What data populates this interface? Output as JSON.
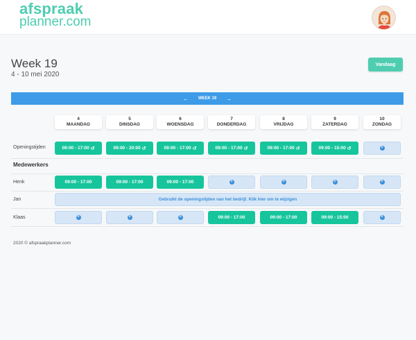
{
  "header": {
    "logo_line1": "afspraak",
    "logo_line2": "planner.com"
  },
  "page": {
    "title": "Week 19",
    "date_range": "4 - 10 mei 2020",
    "today_label": "Vandaag"
  },
  "week_nav": {
    "prev": "←",
    "label": "WEEK 19",
    "next": "→"
  },
  "days": [
    {
      "num": "4",
      "name": "MAANDAG"
    },
    {
      "num": "5",
      "name": "DINSDAG"
    },
    {
      "num": "6",
      "name": "WOENSDAG"
    },
    {
      "num": "7",
      "name": "DONDERDAG"
    },
    {
      "num": "8",
      "name": "VRIJDAG"
    },
    {
      "num": "9",
      "name": "ZATERDAG"
    },
    {
      "num": "10",
      "name": "ZONDAG"
    }
  ],
  "opening_hours": {
    "label": "Openingstijden",
    "slots": [
      "09:00 - 17:00",
      "09:00 - 20:00",
      "09:00 - 17:00",
      "09:00 - 17:00",
      "09:00 - 17:00",
      "09:00 - 15:00",
      ""
    ]
  },
  "staff_section": "Medewerkers",
  "staff": [
    {
      "name": "Henk",
      "slots": [
        "09:00 - 17:00",
        "09:00 - 17:00",
        "09:00 - 17:00",
        "",
        "",
        "",
        ""
      ]
    },
    {
      "name": "Jan",
      "note": "Gebruikt de openingstijden van het bedrijf. Klik hier om te wijzigen"
    },
    {
      "name": "Klaas",
      "slots": [
        "",
        "",
        "",
        "09:00 - 17:00",
        "09:00 - 17:00",
        "09:00 - 15:00",
        ""
      ]
    }
  ],
  "footer": "2020 © afspraakplanner.com",
  "colors": {
    "brand": "#4ecdb0",
    "slot_green": "#17c59c",
    "week_bar": "#3d9be8",
    "empty_slot": "#d6e6f7"
  },
  "icons": {
    "reset": "reset-icon",
    "plus": "plus-icon"
  }
}
